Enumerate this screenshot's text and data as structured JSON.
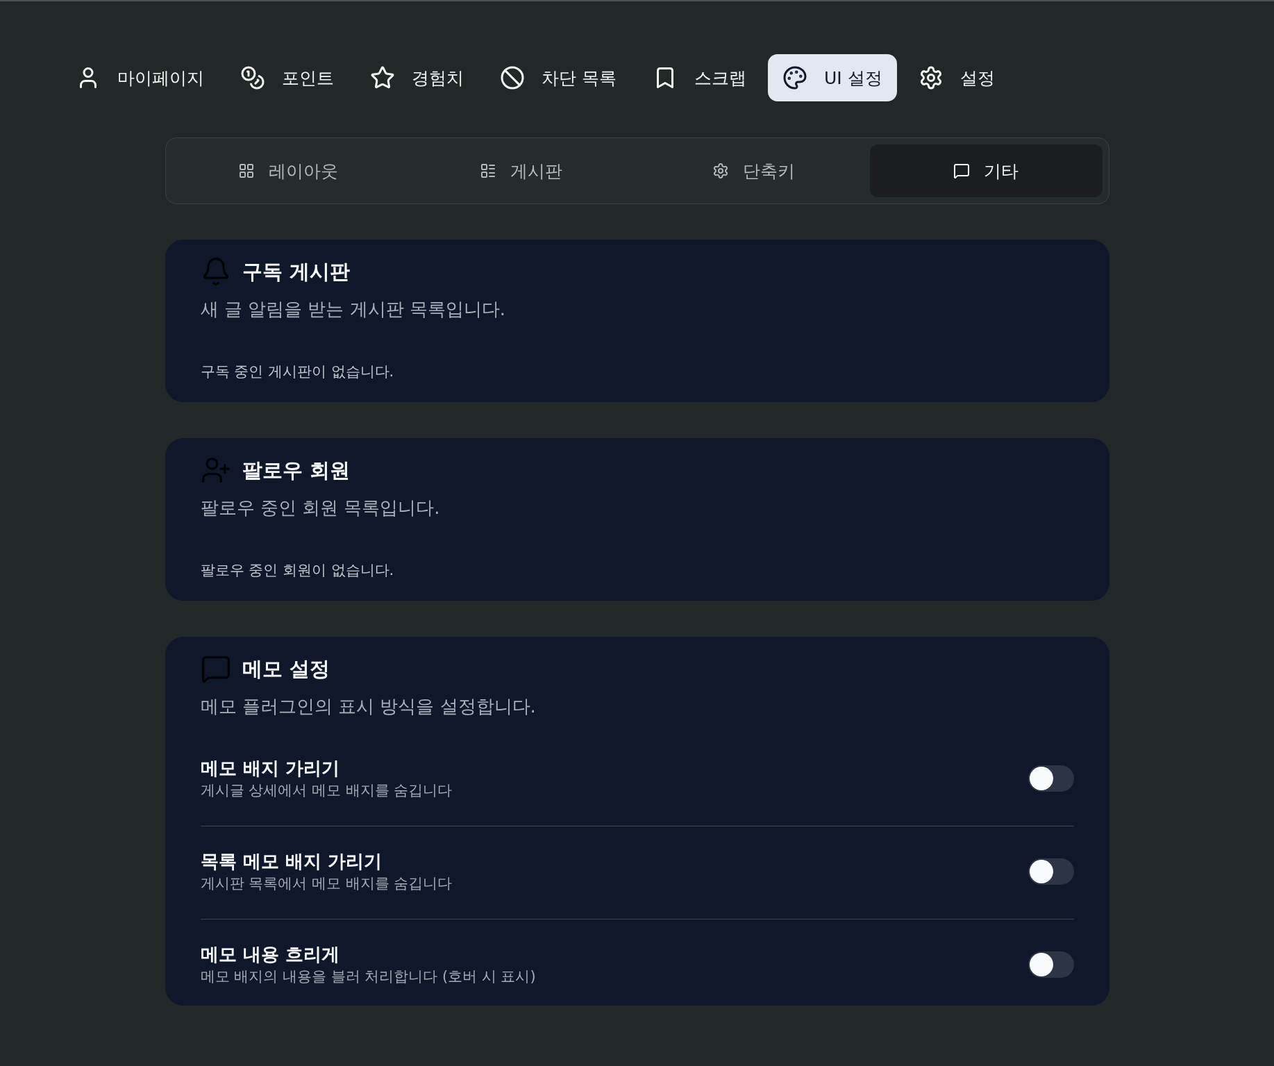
{
  "top_nav": [
    {
      "label": "마이페이지",
      "selected": false
    },
    {
      "label": "포인트",
      "selected": false
    },
    {
      "label": "경험치",
      "selected": false
    },
    {
      "label": "차단 목록",
      "selected": false
    },
    {
      "label": "스크랩",
      "selected": false
    },
    {
      "label": "UI 설정",
      "selected": true
    },
    {
      "label": "설정",
      "selected": false
    }
  ],
  "sub_tabs": [
    {
      "label": "레이아웃",
      "selected": false
    },
    {
      "label": "게시판",
      "selected": false
    },
    {
      "label": "단축키",
      "selected": false
    },
    {
      "label": "기타",
      "selected": true
    }
  ],
  "sections": [
    {
      "kind": "list",
      "title": "구독 게시판",
      "description": "새 글 알림을 받는 게시판 목록입니다.",
      "empty_message": "구독 중인 게시판이 없습니다."
    },
    {
      "kind": "list",
      "title": "팔로우 회원",
      "description": "팔로우 중인 회원 목록입니다.",
      "empty_message": "팔로우 중인 회원이 없습니다."
    },
    {
      "kind": "settings",
      "title": "메모 설정",
      "description": "메모 플러그인의 표시 방식을 설정합니다.",
      "settings": [
        {
          "label": "메모 배지 가리기",
          "description": "게시글 상세에서 메모 배지를 숨깁니다",
          "on": false
        },
        {
          "label": "목록 메모 배지 가리기",
          "description": "게시판 목록에서 메모 배지를 숨깁니다",
          "on": false
        },
        {
          "label": "메모 내용 흐리게",
          "description": "메모 배지의 내용을 블러 처리합니다 (호버 시 표시)",
          "on": false
        }
      ]
    }
  ]
}
